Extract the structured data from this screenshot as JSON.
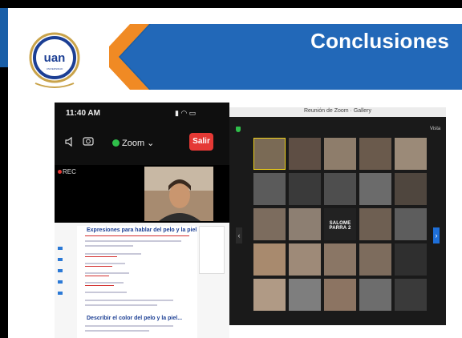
{
  "slide": {
    "title": "Conclusiones",
    "logo_text": "uan",
    "logo_subtext": "UNIVERSIDAD ANTONIO NARIÑO",
    "colors": {
      "banner_blue": "#1a5fa8",
      "accent_orange": "#f08a24",
      "logo_gold": "#c9a34a",
      "logo_navy": "#1c3f94"
    }
  },
  "phone": {
    "time": "11:40 AM",
    "status_icons": "signal wifi battery",
    "zoom_label": "Zoom ⌄",
    "leave_label": "Salir",
    "rec_label": "REC",
    "doc_heading": "Expresiones para hablar del pelo y la piel",
    "doc_heading2": "Describir el color del pelo y la piel..."
  },
  "gallery": {
    "window_title": "Reunión de Zoom · Gallery",
    "view_label": "Vista",
    "center_name": "SALOME PARRA 2"
  }
}
